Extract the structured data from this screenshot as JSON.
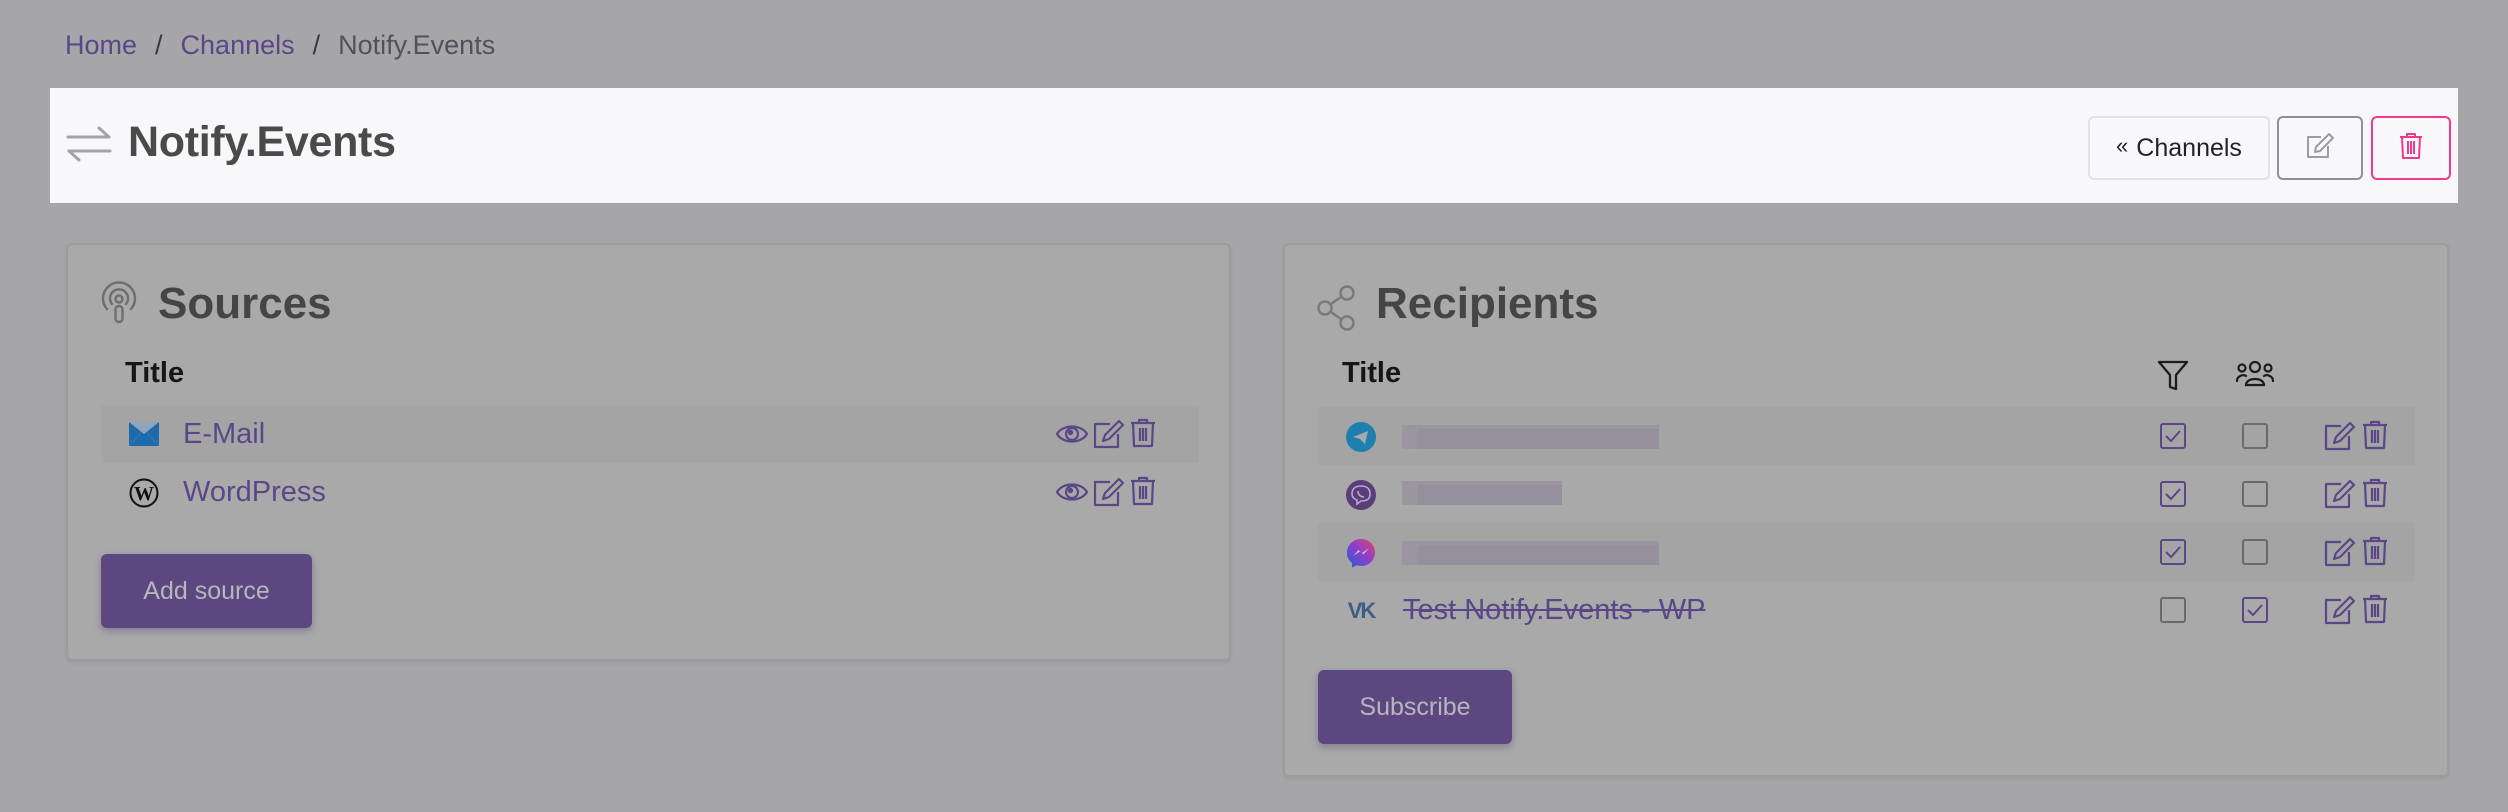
{
  "breadcrumb": {
    "items": [
      {
        "label": "Home",
        "link": true
      },
      {
        "label": "Channels",
        "link": true
      },
      {
        "label": "Notify.Events",
        "link": false
      }
    ],
    "separator": "/"
  },
  "header": {
    "icon": "arrows-exchange-icon",
    "title": "Notify.Events",
    "buttons": {
      "channels_label": "Channels",
      "channels_icon": "double-chevron-left-icon",
      "edit_icon": "edit-icon",
      "delete_icon": "trash-icon"
    }
  },
  "sources": {
    "title": "Sources",
    "icon": "podcast-icon",
    "column_title": "Title",
    "rows": [
      {
        "icon": "email-icon",
        "label": "E-Mail",
        "actions": [
          "view",
          "edit",
          "delete"
        ]
      },
      {
        "icon": "wordpress-icon",
        "label": "WordPress",
        "actions": [
          "view",
          "edit",
          "delete"
        ]
      }
    ],
    "add_button": "Add source"
  },
  "recipients": {
    "title": "Recipients",
    "icon": "share-icon",
    "column_title": "Title",
    "column_filter_icon": "filter-icon",
    "column_group_icon": "people-icon",
    "rows": [
      {
        "icon": "telegram-icon",
        "label": "",
        "blurred": true,
        "filter": true,
        "group": false,
        "disabled": false
      },
      {
        "icon": "viber-icon",
        "label": "",
        "blurred": true,
        "filter": true,
        "group": false,
        "disabled": false
      },
      {
        "icon": "messenger-icon",
        "label": "",
        "blurred": true,
        "filter": true,
        "group": false,
        "disabled": false
      },
      {
        "icon": "vk-icon",
        "label": "Test Notify.Events - WP",
        "blurred": false,
        "filter": false,
        "group": true,
        "disabled": true
      }
    ],
    "subscribe_button": "Subscribe"
  },
  "colors": {
    "accent": "#5b4788",
    "button_primary": "#5c4780",
    "danger": "#f0388c",
    "header_bg": "#f8f7fa",
    "page_bg": "#a6a5a8"
  }
}
